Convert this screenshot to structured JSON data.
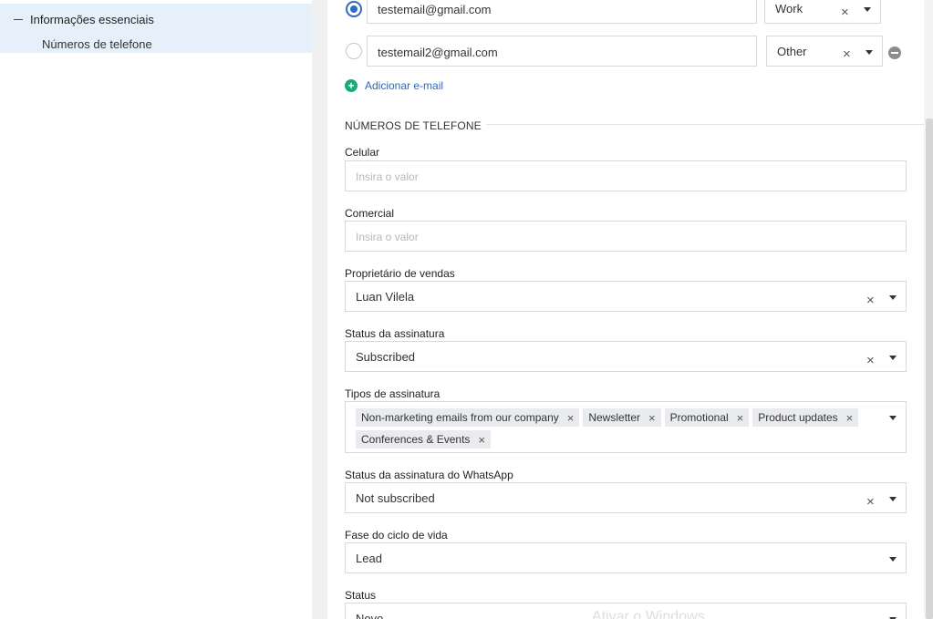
{
  "sidebar": {
    "section_label": "Informações essenciais",
    "sub_item": "Números de telefone"
  },
  "emails": [
    {
      "value": "testemail@gmail.com",
      "type": "Work",
      "primary": true
    },
    {
      "value": "testemail2@gmail.com",
      "type": "Other",
      "primary": false
    }
  ],
  "add_email_label": "Adicionar e-mail",
  "phone_section_title": "NÚMEROS DE TELEFONE",
  "fields": {
    "celular": {
      "label": "Celular",
      "placeholder": "Insira o valor"
    },
    "comercial": {
      "label": "Comercial",
      "placeholder": "Insira o valor"
    },
    "owner": {
      "label": "Proprietário de vendas",
      "value": "Luan Vilela"
    },
    "subscription_status": {
      "label": "Status da assinatura",
      "value": "Subscribed"
    },
    "subscription_types": {
      "label": "Tipos de assinatura",
      "tags": [
        "Non-marketing emails from our company",
        "Newsletter",
        "Promotional",
        "Product updates",
        "Conferences & Events"
      ]
    },
    "whatsapp_status": {
      "label": "Status da assinatura do WhatsApp",
      "value": "Not subscribed"
    },
    "lifecycle": {
      "label": "Fase do ciclo de vida",
      "value": "Lead"
    },
    "status": {
      "label": "Status",
      "value": "Novo"
    }
  },
  "watermark": "Ativar o Windows"
}
